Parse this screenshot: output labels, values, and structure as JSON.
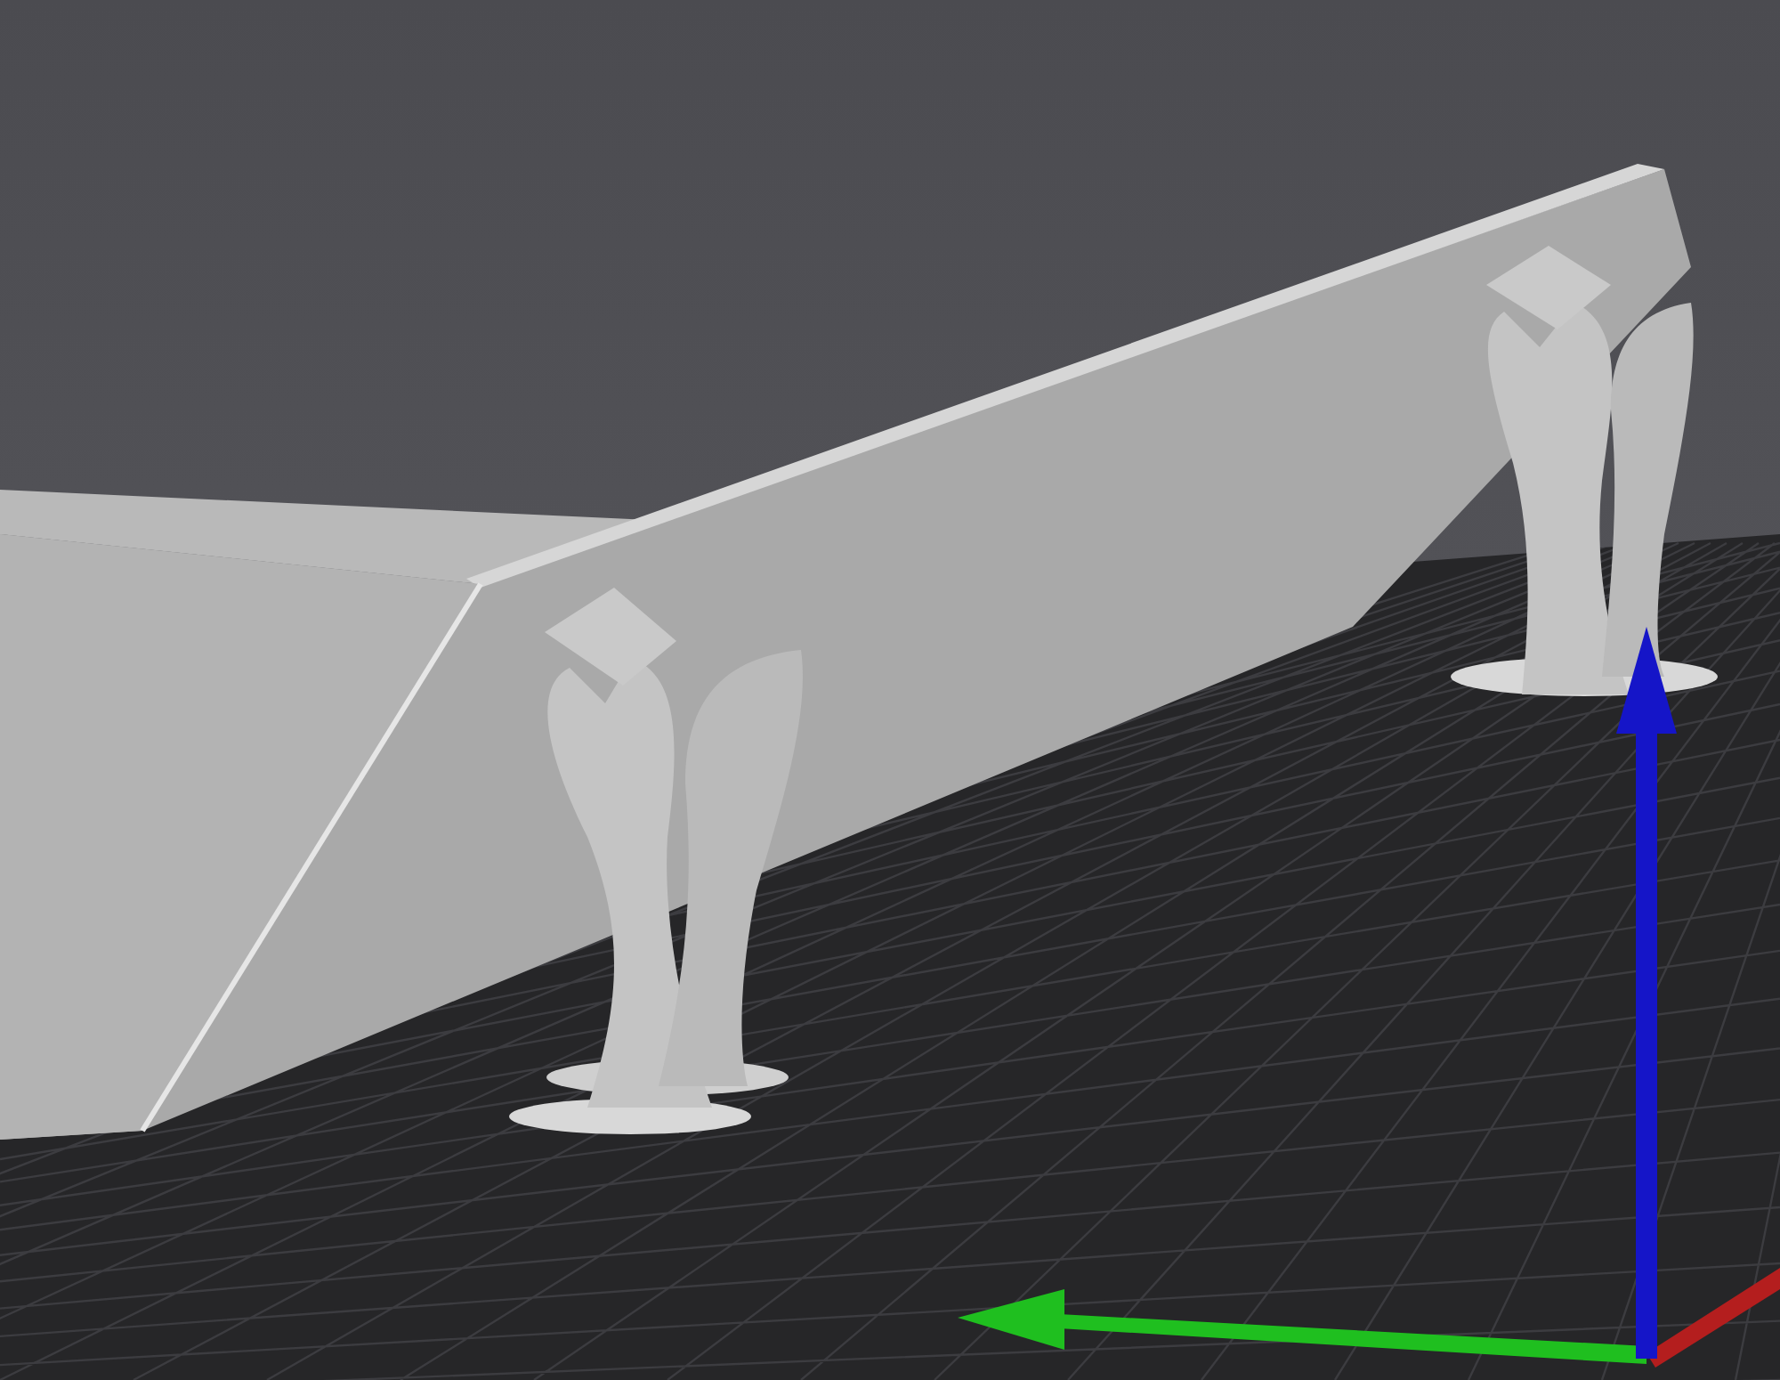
{
  "scene": {
    "grid": true,
    "axes": true
  }
}
